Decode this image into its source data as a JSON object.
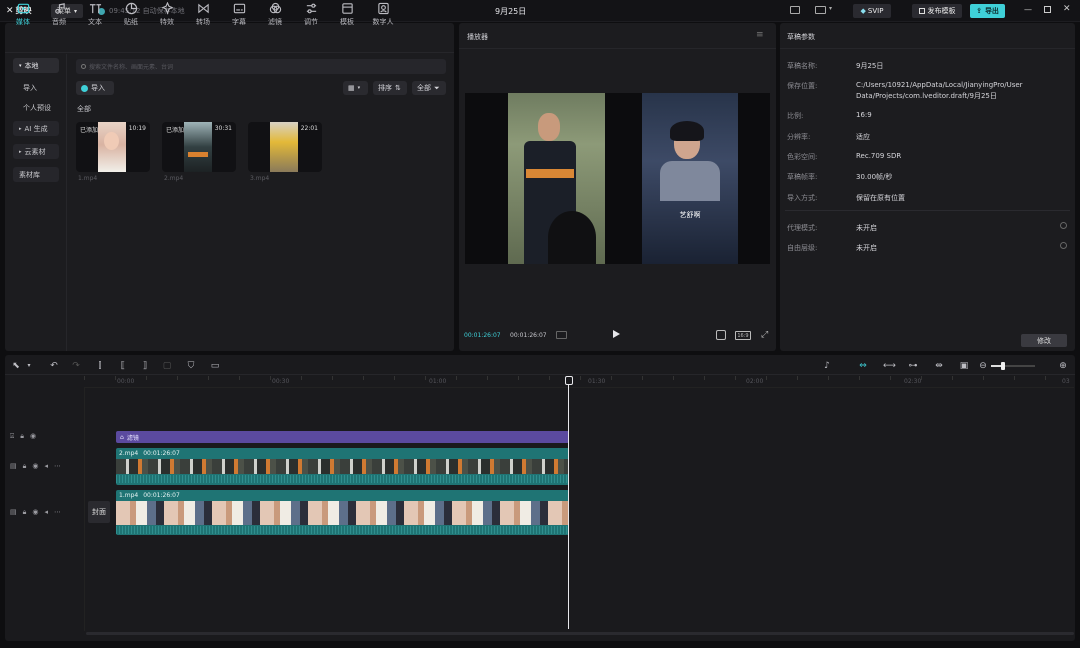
{
  "app": {
    "logo": "剪映",
    "menu_label": "菜单",
    "autosave": "09:45:12 自动保存本地",
    "project_title": "9月25日",
    "svip": "SVIP",
    "publish_template": "发布模板",
    "export": "导出"
  },
  "toolbar": {
    "tabs": [
      {
        "label": "媒体",
        "icon": "media-icon",
        "active": true
      },
      {
        "label": "音频",
        "icon": "audio-icon"
      },
      {
        "label": "文本",
        "icon": "text-icon"
      },
      {
        "label": "贴纸",
        "icon": "sticker-icon"
      },
      {
        "label": "特效",
        "icon": "effects-icon"
      },
      {
        "label": "转场",
        "icon": "transition-icon"
      },
      {
        "label": "字幕",
        "icon": "caption-icon"
      },
      {
        "label": "滤镜",
        "icon": "filter-icon"
      },
      {
        "label": "调节",
        "icon": "adjust-icon"
      },
      {
        "label": "模板",
        "icon": "template-icon"
      },
      {
        "label": "数字人",
        "icon": "digital-human-icon"
      }
    ]
  },
  "sidebar": {
    "items": [
      {
        "label": "本地",
        "active": true
      },
      {
        "label": "导入"
      },
      {
        "label": "个人预设"
      },
      {
        "label": "AI 生成"
      },
      {
        "label": "云素材"
      },
      {
        "label": "素材库"
      }
    ]
  },
  "media": {
    "search_placeholder": "搜索文件名称、画面元素、台词",
    "import_label": "导入",
    "sort_label": "排序",
    "filter_label": "全部",
    "section_label": "全部",
    "items": [
      {
        "badge": "已添加",
        "duration": "10:19",
        "name": "1.mp4"
      },
      {
        "badge": "已添加",
        "duration": "30:31",
        "name": "2.mp4"
      },
      {
        "badge": "",
        "duration": "22:01",
        "name": "3.mp4"
      }
    ]
  },
  "player": {
    "title": "播放器",
    "current": "00:01:26:07",
    "total": "00:01:26:07",
    "caption": "艺舒啊",
    "ratio": "比例"
  },
  "draft": {
    "title": "草稿参数",
    "rows": [
      {
        "label": "草稿名称:",
        "value": "9月25日"
      },
      {
        "label": "保存位置:",
        "value": "C:/Users/10921/AppData/Local/JianyingPro/User Data/Projects/com.lveditor.draft/9月25日"
      },
      {
        "label": "比例:",
        "value": "16:9"
      },
      {
        "label": "分辨率:",
        "value": "适应"
      },
      {
        "label": "色彩空间:",
        "value": "Rec.709 SDR"
      },
      {
        "label": "草稿帧率:",
        "value": "30.00帧/秒"
      },
      {
        "label": "导入方式:",
        "value": "保留在原有位置"
      },
      {
        "label": "代理模式:",
        "value": "未开启"
      },
      {
        "label": "自由层级:",
        "value": "未开启"
      }
    ],
    "edit_label": "修改"
  },
  "timeline": {
    "ruler": [
      "00:00",
      "00:30",
      "01:00",
      "01:30",
      "02:00",
      "02:30",
      "03"
    ],
    "filter_track": "滤镜",
    "track2": {
      "name": "2.mp4",
      "duration": "00:01:26:07"
    },
    "track1": {
      "name": "1.mp4",
      "duration": "00:01:26:07"
    },
    "cover_label": "封面"
  },
  "colors": {
    "accent": "#3fd0d8",
    "filter": "#5b4a9f",
    "video": "#1f7474",
    "bg": "#1c1c1f"
  }
}
